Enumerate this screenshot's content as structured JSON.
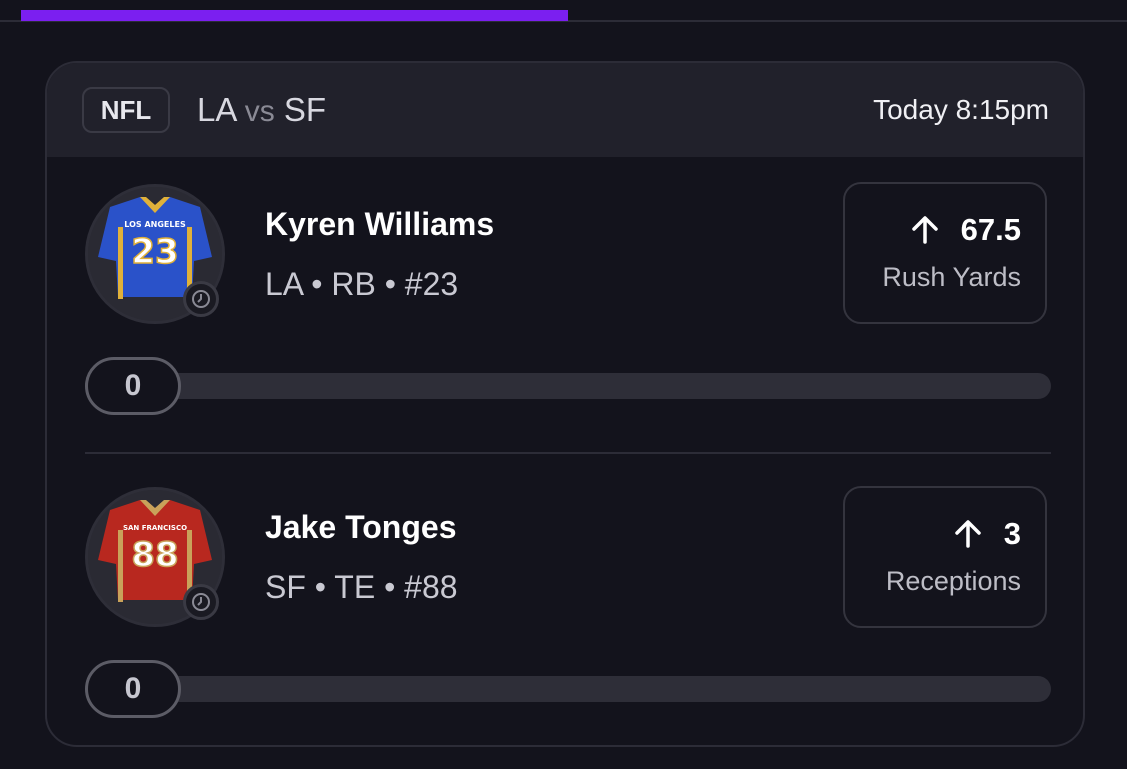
{
  "top_progress": {
    "fraction": 0.485,
    "color": "#7b1ff0"
  },
  "game": {
    "league": "NFL",
    "away_team": "LA",
    "vs_label": "vs",
    "home_team": "SF",
    "time": "Today 8:15pm"
  },
  "players": [
    {
      "name": "Kyren Williams",
      "meta": "LA • RB • #23",
      "jersey_text": "LOS ANGELES",
      "jersey_number": "23",
      "jersey_color": "#2a52c9",
      "prop_direction_icon": "arrow-up-icon",
      "prop_line": "67.5",
      "prop_stat": "Rush Yards",
      "current_value": "0",
      "progress_fraction": 0
    },
    {
      "name": "Jake Tonges",
      "meta": "SF • TE • #88",
      "jersey_text": "SAN FRANCISCO",
      "jersey_number": "88",
      "jersey_color": "#b8281f",
      "prop_direction_icon": "arrow-up-icon",
      "prop_line": "3",
      "prop_stat": "Receptions",
      "current_value": "0",
      "progress_fraction": 0
    }
  ]
}
